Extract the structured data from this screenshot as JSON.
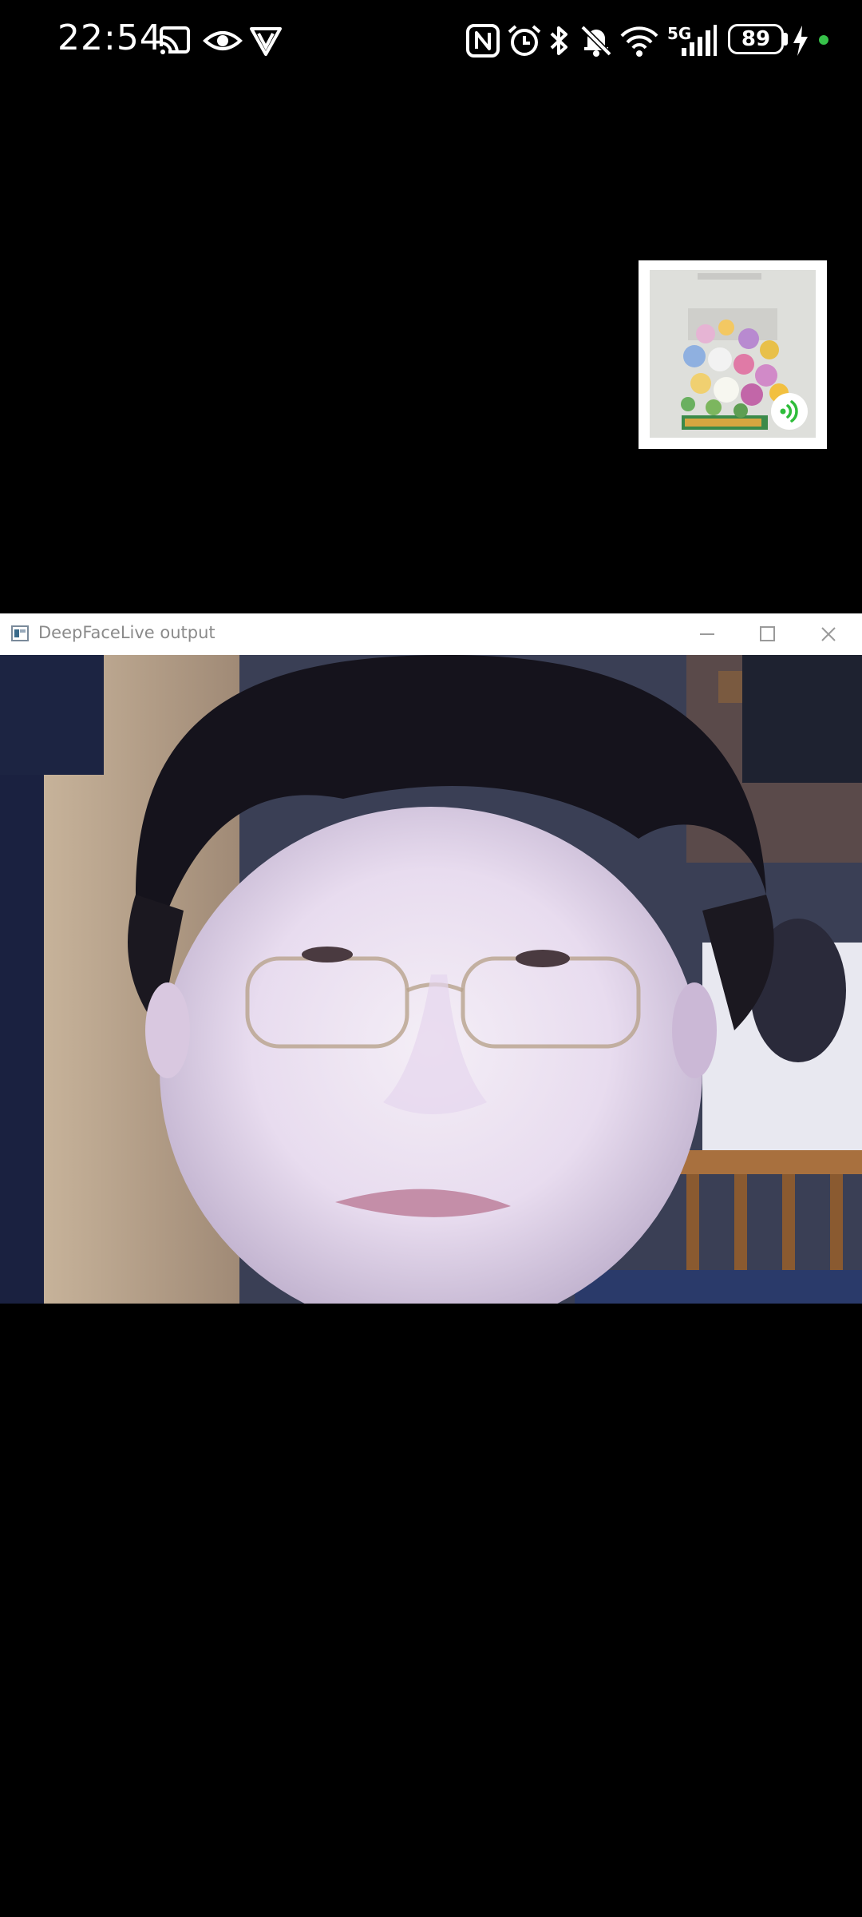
{
  "status_bar": {
    "time": "22:54",
    "battery": "89",
    "network": "5G",
    "icons": [
      "cast-icon",
      "eye-icon",
      "vpn-icon",
      "nfc-icon",
      "alarm-icon",
      "bluetooth-icon",
      "mute-icon",
      "wifi-icon",
      "signal-icon",
      "charging-icon"
    ]
  },
  "pip": {
    "icon": "speaker-icon",
    "accent_color": "#2ebd3a"
  },
  "window": {
    "title": "DeepFaceLive output",
    "buttons": [
      "minimize-icon",
      "maximize-icon",
      "close-icon"
    ]
  },
  "colors": {
    "background": "#000000",
    "status_dot": "#37c24a"
  }
}
